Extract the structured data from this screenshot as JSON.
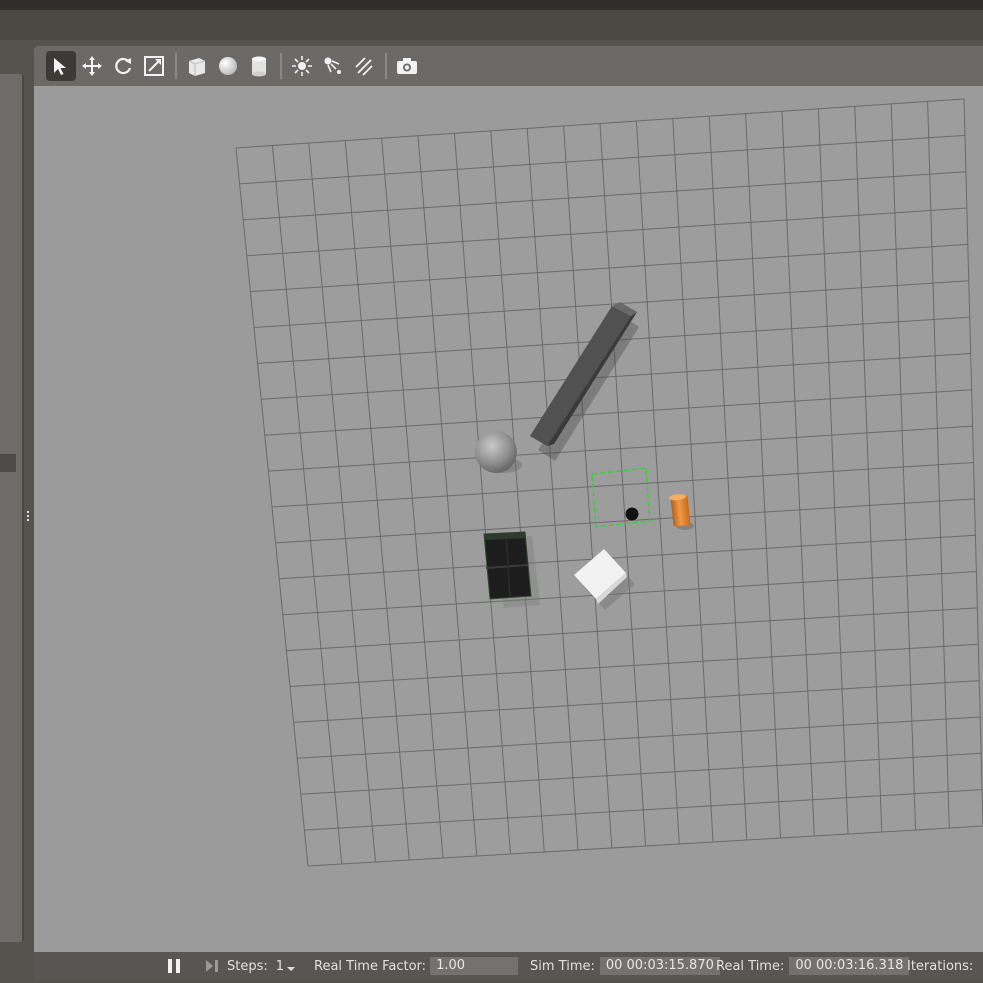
{
  "toolbar": {
    "tools": [
      {
        "name": "select-tool-icon",
        "active": true
      },
      {
        "name": "translate-tool-icon"
      },
      {
        "name": "rotate-tool-icon"
      },
      {
        "name": "scale-tool-icon"
      },
      {
        "name": "box-shape-icon"
      },
      {
        "name": "sphere-shape-icon"
      },
      {
        "name": "cylinder-shape-icon"
      },
      {
        "name": "point-light-icon"
      },
      {
        "name": "spot-light-icon"
      },
      {
        "name": "directional-light-icon"
      },
      {
        "name": "screenshot-camera-icon"
      }
    ]
  },
  "status": {
    "steps_label": "Steps:",
    "steps_value": "1",
    "rtf_label": "Real Time Factor:",
    "rtf_value": "1.00",
    "sim_time_label": "Sim Time:",
    "sim_time_value": "00 00:03:15.870",
    "real_time_label": "Real Time:",
    "real_time_value": "00 00:03:16.318",
    "iterations_label": "Iterations:"
  },
  "colors": {
    "ground": "#9d9d9d",
    "grid_line": "#6a6a6a",
    "cylinder": "#e0822c",
    "selection": "#32d232",
    "beam": "#4b4b4b"
  }
}
